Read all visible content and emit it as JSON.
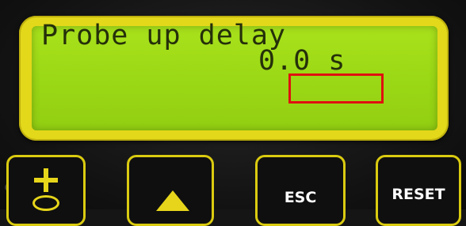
{
  "display": {
    "line1": "Probe up delay",
    "line2": "0.0 s"
  },
  "buttons": {
    "plus_icon": "plus-icon",
    "probe_icon": "probe-icon",
    "up_icon": "up-arrow-icon",
    "esc_label": "ESC",
    "reset_label": "RESET"
  },
  "colors": {
    "lcd_background": "#9bd815",
    "bezel": "#e3d81a",
    "highlight": "#e01010",
    "panel": "#151515"
  }
}
